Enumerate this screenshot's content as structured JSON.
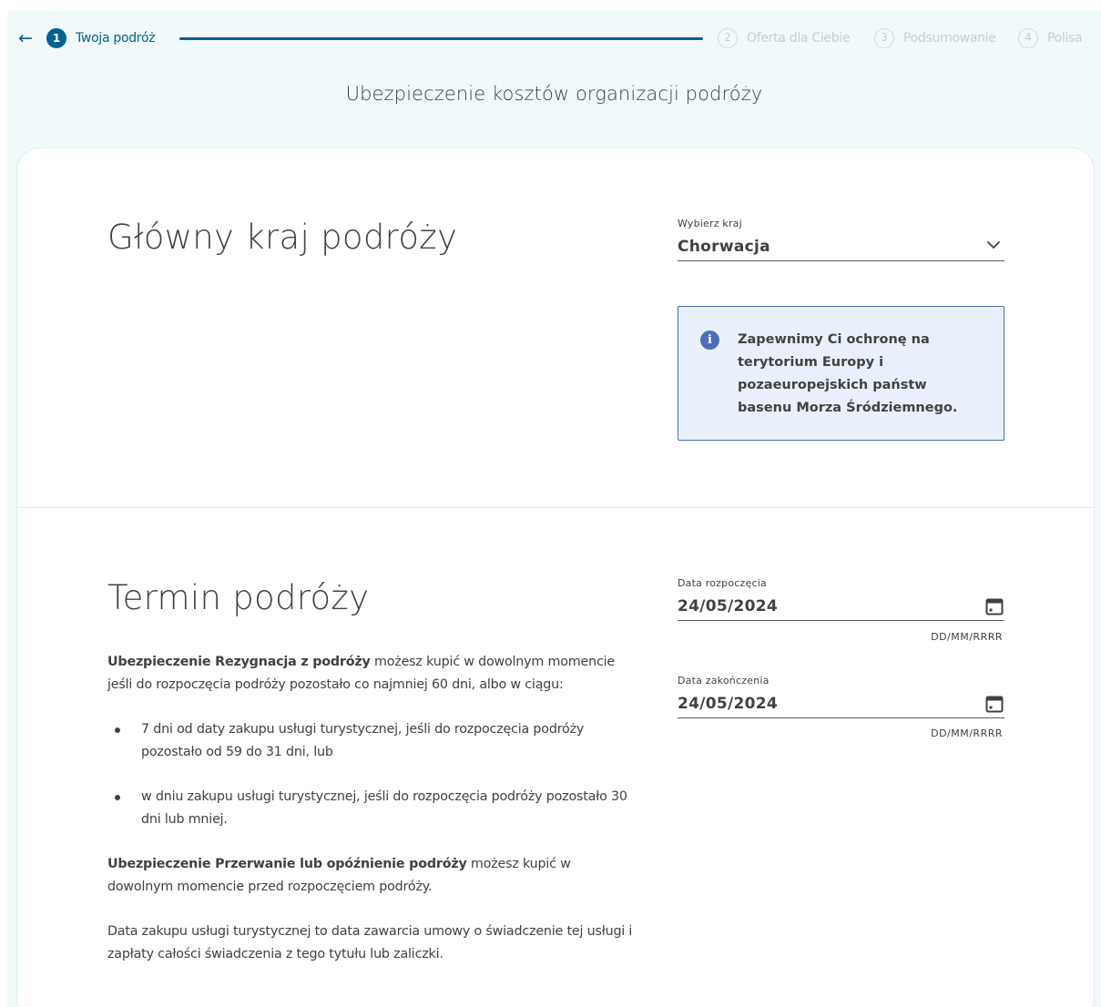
{
  "stepper": {
    "back_icon": "left-arrow-icon",
    "steps": [
      {
        "number": "1",
        "label": "Twoja podróż",
        "active": true
      },
      {
        "number": "2",
        "label": "Oferta dla Ciebie",
        "active": false
      },
      {
        "number": "3",
        "label": "Podsumowanie",
        "active": false
      },
      {
        "number": "4",
        "label": "Polisa",
        "active": false
      }
    ],
    "progress_percent": 100
  },
  "page_title": "Ubezpieczenie kosztów organizacji podróży",
  "country_section": {
    "heading": "Główny kraj podróży",
    "select_label": "Wybierz kraj",
    "select_value": "Chorwacja",
    "info_text": "Zapewnimy Ci ochronę na terytorium Europy i pozaeuropejskich państw basenu Morza Śródziemnego."
  },
  "dates_section": {
    "heading": "Termin podróży",
    "start_label": "Data rozpoczęcia",
    "start_value": "24/05/2024",
    "start_hint": "DD/MM/RRRR",
    "end_label": "Data zakończenia",
    "end_value": "24/05/2024",
    "end_hint": "DD/MM/RRRR",
    "para1_bold": "Ubezpieczenie Rezygnacja z podróży",
    "para1_rest": " możesz kupić w dowolnym momencie jeśli do rozpoczęcia podróży pozostało co najmniej 60 dni, albo w ciągu:",
    "bullets": [
      "7 dni od daty zakupu usługi turystycznej, jeśli do rozpoczęcia podróży pozostało od 59 do 31 dni, lub",
      "w dniu zakupu usługi turystycznej, jeśli do rozpoczęcia podróży pozostało 30 dni lub mniej."
    ],
    "para2_bold": "Ubezpieczenie Przerwanie lub opóźnienie podróży",
    "para2_rest": " możesz kupić w dowolnym momencie przed rozpoczęciem podróży.",
    "para3": "Data zakupu usługi turystycznej to data zawarcia umowy o świadczenie tej usługi i zapłaty całości świadczenia z tego tytułu lub zaliczki."
  },
  "colors": {
    "primary": "#006192",
    "info_border": "#496ebd",
    "info_bg": "#eaf0fb",
    "page_bg": "#f1f9fa",
    "inactive_step": "#c4cdd2"
  }
}
